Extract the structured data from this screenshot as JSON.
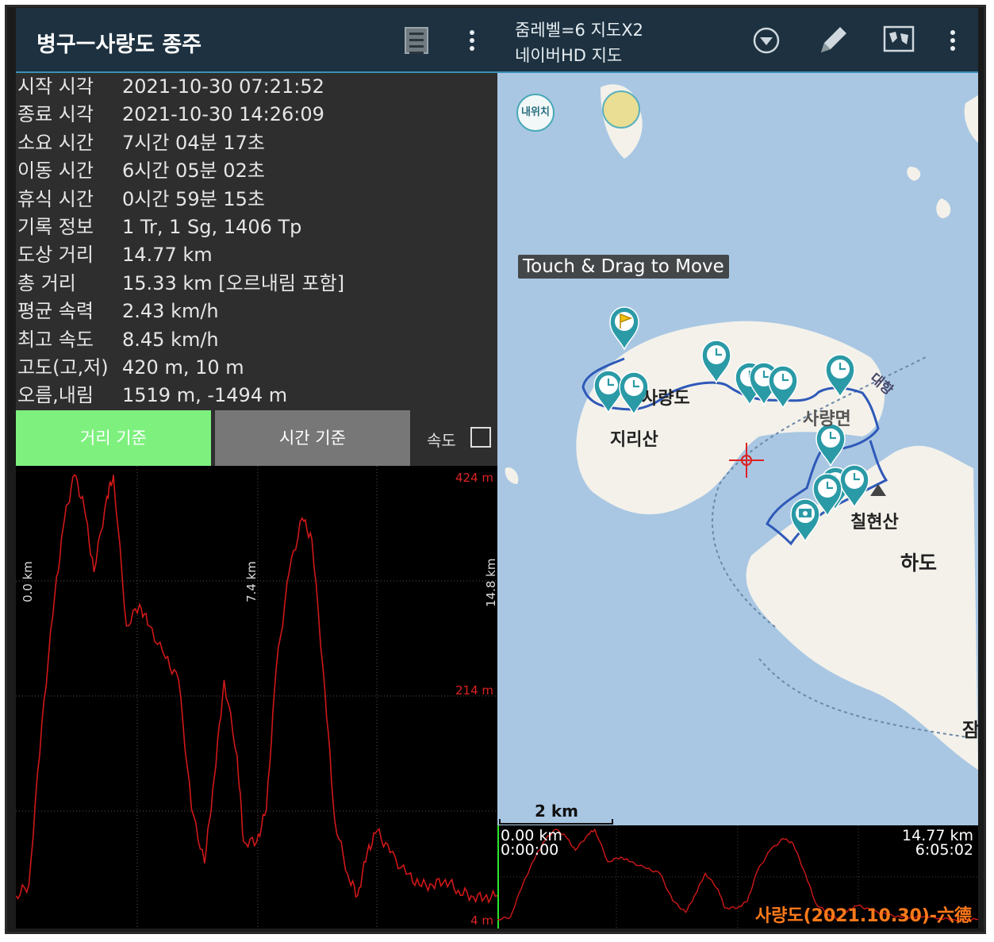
{
  "left_panel": {
    "title": "병구ㅡ사랑도 종주",
    "stats": [
      {
        "key": "시작 시각",
        "value": "2021-10-30 07:21:52"
      },
      {
        "key": "종료 시각",
        "value": "2021-10-30 14:26:09"
      },
      {
        "key": "소요 시간",
        "value": "7시간 04분 17초"
      },
      {
        "key": "이동 시간",
        "value": "6시간 05분 02초"
      },
      {
        "key": "휴식 시간",
        "value": "0시간 59분 15초"
      },
      {
        "key": "기록 정보",
        "value": "1 Tr, 1 Sg, 1406 Tp"
      },
      {
        "key": "도상 거리",
        "value": "14.77 km"
      },
      {
        "key": "총 거리",
        "value": "15.33 km [오르내림 포함]"
      },
      {
        "key": "평균 속력",
        "value": "2.43 km/h"
      },
      {
        "key": "최고 속도",
        "value": "8.45 km/h"
      },
      {
        "key": "고도(고,저)",
        "value": "420 m, 10 m"
      },
      {
        "key": "오름,내림",
        "value": "1519 m, -1494 m"
      }
    ],
    "tabs": {
      "distance": "거리 기준",
      "time": "시간 기준",
      "speed_label": "속도"
    },
    "chart": {
      "y_labels": {
        "top": "424 m",
        "mid": "214 m",
        "bottom": "4 m"
      },
      "x_labels": {
        "start": "0.0 km",
        "mid": "7.4 km",
        "end": "14.8 km"
      }
    }
  },
  "right_panel": {
    "zoom_line1": "줌레벨=6 지도X2",
    "zoom_line2": "네이버HD 지도",
    "my_location": "내위치",
    "tooltip": "Touch & Drag to Move",
    "map_labels": [
      "사량도",
      "지리산",
      "사량면",
      "칠현산",
      "하도",
      "대항",
      "잠"
    ],
    "scale": "2 km",
    "mini_chart": {
      "start_dist": "0.00 km",
      "start_time": "0:00:00",
      "end_dist": "14.77 km",
      "end_time": "6:05:02"
    },
    "watermark": "사량도(2021.10.30)-六德"
  },
  "chart_data": {
    "type": "line",
    "title": "",
    "xlabel": "",
    "ylabel": "",
    "x_unit": "km",
    "y_unit": "m",
    "xlim": [
      0,
      14.8
    ],
    "ylim": [
      4,
      424
    ],
    "series": [
      {
        "x": [
          0,
          0.4,
          0.8,
          1.2,
          1.5,
          1.8,
          2.1,
          2.4,
          2.8,
          3.0,
          3.4,
          3.8,
          4.1,
          4.6,
          5.0,
          5.4,
          5.8,
          6.1,
          6.4,
          6.8,
          7.0,
          7.4,
          7.7,
          8.0,
          8.4,
          8.8,
          9.1,
          9.5,
          9.8,
          10.2,
          10.5,
          10.8,
          11.1,
          11.5,
          12.0,
          12.4,
          12.8,
          13.2,
          13.6,
          14.0,
          14.4,
          14.8
        ],
        "y": [
          30,
          40,
          190,
          310,
          380,
          420,
          390,
          330,
          400,
          420,
          280,
          300,
          280,
          250,
          230,
          110,
          60,
          140,
          230,
          160,
          80,
          80,
          110,
          240,
          330,
          380,
          360,
          220,
          100,
          50,
          30,
          70,
          90,
          70,
          50,
          40,
          40,
          45,
          35,
          30,
          28,
          30
        ]
      }
    ],
    "grid": true
  }
}
